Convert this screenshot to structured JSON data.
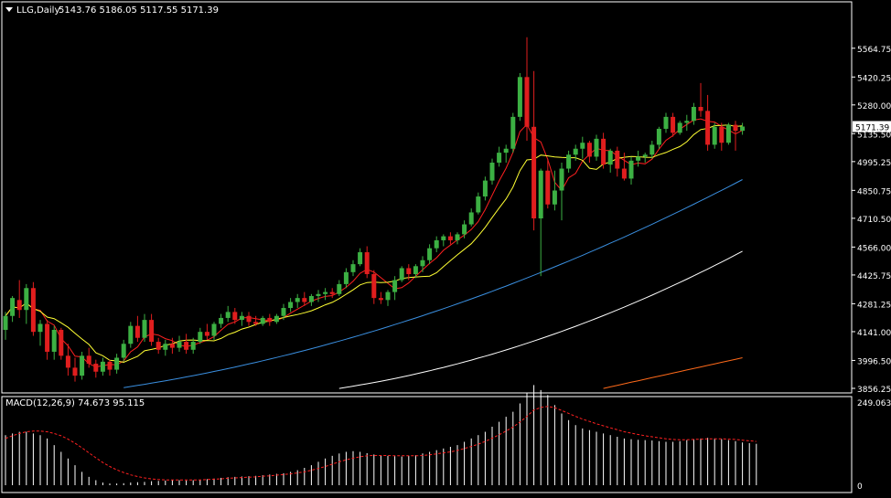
{
  "header": {
    "symbol_label": "LLG,Daily",
    "ohlc_text": "5143.76 5186.05 5117.55 5171.39"
  },
  "colors": {
    "background": "#000000",
    "bull": "#3cb043",
    "bear": "#e01e1e",
    "ma_fast": "#ff2020",
    "ma_mid": "#ffff33",
    "ma_50": "#3a8fe0",
    "ma_100": "#ffffff",
    "ma_200": "#ff6a1a",
    "grid": "#ffffff",
    "macd_hist": "#ffffff",
    "macd_signal": "#ff2020"
  },
  "chart_data": [
    {
      "type": "candlestick",
      "title": "LLG,Daily",
      "ylim": [
        3856.25,
        5664.75
      ],
      "yticks": [
        "5564.75",
        "5420.25",
        "5280.00",
        "5135.50",
        "4995.25",
        "4850.75",
        "4710.50",
        "4566.00",
        "4425.75",
        "4281.25",
        "4141.00",
        "3996.50",
        "3856.25"
      ],
      "last_price_label": "5171.39",
      "last_price": 5171.39,
      "candles": [
        [
          4150,
          4240,
          4100,
          4220
        ],
        [
          4220,
          4320,
          4190,
          4310
        ],
        [
          4300,
          4400,
          4210,
          4250
        ],
        [
          4250,
          4380,
          4180,
          4360
        ],
        [
          4360,
          4390,
          4120,
          4140
        ],
        [
          4140,
          4200,
          4070,
          4180
        ],
        [
          4180,
          4200,
          4000,
          4040
        ],
        [
          4040,
          4170,
          4000,
          4150
        ],
        [
          4150,
          4160,
          4000,
          4020
        ],
        [
          4020,
          4080,
          3920,
          3960
        ],
        [
          3960,
          4010,
          3890,
          3920
        ],
        [
          3920,
          4040,
          3900,
          4020
        ],
        [
          4020,
          4060,
          3960,
          3980
        ],
        [
          3980,
          4000,
          3910,
          3940
        ],
        [
          3940,
          4010,
          3920,
          3990
        ],
        [
          3990,
          4000,
          3920,
          3950
        ],
        [
          3950,
          4030,
          3930,
          4010
        ],
        [
          4010,
          4100,
          3990,
          4080
        ],
        [
          4080,
          4190,
          4060,
          4170
        ],
        [
          4170,
          4220,
          4090,
          4110
        ],
        [
          4110,
          4230,
          4090,
          4200
        ],
        [
          4200,
          4230,
          4070,
          4090
        ],
        [
          4090,
          4110,
          4030,
          4050
        ],
        [
          4050,
          4100,
          4020,
          4080
        ],
        [
          4080,
          4110,
          4030,
          4060
        ],
        [
          4060,
          4120,
          4040,
          4090
        ],
        [
          4090,
          4130,
          4030,
          4050
        ],
        [
          4050,
          4110,
          4030,
          4090
        ],
        [
          4090,
          4160,
          4080,
          4140
        ],
        [
          4140,
          4180,
          4100,
          4120
        ],
        [
          4120,
          4190,
          4100,
          4180
        ],
        [
          4180,
          4230,
          4160,
          4210
        ],
        [
          4210,
          4270,
          4190,
          4240
        ],
        [
          4240,
          4260,
          4180,
          4200
        ],
        [
          4200,
          4240,
          4170,
          4220
        ],
        [
          4220,
          4240,
          4170,
          4190
        ],
        [
          4190,
          4220,
          4170,
          4180
        ],
        [
          4180,
          4220,
          4170,
          4210
        ],
        [
          4210,
          4230,
          4170,
          4190
        ],
        [
          4190,
          4230,
          4180,
          4220
        ],
        [
          4220,
          4280,
          4200,
          4260
        ],
        [
          4260,
          4310,
          4240,
          4290
        ],
        [
          4290,
          4330,
          4260,
          4310
        ],
        [
          4310,
          4340,
          4270,
          4290
        ],
        [
          4290,
          4330,
          4270,
          4320
        ],
        [
          4320,
          4350,
          4290,
          4330
        ],
        [
          4330,
          4360,
          4300,
          4340
        ],
        [
          4340,
          4360,
          4310,
          4330
        ],
        [
          4330,
          4400,
          4320,
          4380
        ],
        [
          4380,
          4460,
          4360,
          4440
        ],
        [
          4440,
          4500,
          4420,
          4480
        ],
        [
          4480,
          4560,
          4470,
          4540
        ],
        [
          4540,
          4570,
          4410,
          4430
        ],
        [
          4430,
          4450,
          4280,
          4310
        ],
        [
          4310,
          4340,
          4280,
          4300
        ],
        [
          4300,
          4350,
          4270,
          4340
        ],
        [
          4340,
          4420,
          4300,
          4400
        ],
        [
          4400,
          4470,
          4390,
          4460
        ],
        [
          4460,
          4480,
          4400,
          4430
        ],
        [
          4430,
          4480,
          4410,
          4470
        ],
        [
          4470,
          4520,
          4440,
          4500
        ],
        [
          4500,
          4580,
          4480,
          4560
        ],
        [
          4560,
          4620,
          4540,
          4600
        ],
        [
          4600,
          4630,
          4570,
          4620
        ],
        [
          4620,
          4640,
          4580,
          4600
        ],
        [
          4600,
          4640,
          4580,
          4630
        ],
        [
          4630,
          4700,
          4610,
          4680
        ],
        [
          4680,
          4760,
          4670,
          4740
        ],
        [
          4740,
          4840,
          4730,
          4820
        ],
        [
          4820,
          4920,
          4800,
          4900
        ],
        [
          4900,
          5010,
          4880,
          4990
        ],
        [
          4990,
          5070,
          4970,
          5040
        ],
        [
          5040,
          5080,
          4990,
          5060
        ],
        [
          5060,
          5240,
          5040,
          5220
        ],
        [
          5220,
          5440,
          5200,
          5420
        ],
        [
          5420,
          5620,
          5100,
          5170
        ],
        [
          5170,
          5450,
          4650,
          4710
        ],
        [
          4710,
          4960,
          4420,
          4950
        ],
        [
          4950,
          5010,
          4760,
          4780
        ],
        [
          4780,
          4950,
          4750,
          4850
        ],
        [
          4850,
          4990,
          4700,
          4960
        ],
        [
          4960,
          5050,
          4940,
          5030
        ],
        [
          5030,
          5080,
          5000,
          5060
        ],
        [
          5060,
          5120,
          5010,
          5090
        ],
        [
          5090,
          5100,
          4990,
          5020
        ],
        [
          5020,
          5130,
          5000,
          5110
        ],
        [
          5110,
          5140,
          4960,
          4980
        ],
        [
          4980,
          5060,
          4940,
          5050
        ],
        [
          5050,
          5070,
          4920,
          4960
        ],
        [
          4960,
          5040,
          4900,
          4910
        ],
        [
          4910,
          5020,
          4880,
          5000
        ],
        [
          5000,
          5050,
          4970,
          5020
        ],
        [
          5020,
          5040,
          4990,
          5030
        ],
        [
          5030,
          5100,
          5010,
          5080
        ],
        [
          5080,
          5170,
          5060,
          5160
        ],
        [
          5160,
          5240,
          5140,
          5220
        ],
        [
          5220,
          5240,
          5120,
          5140
        ],
        [
          5140,
          5200,
          5130,
          5190
        ],
        [
          5190,
          5230,
          5150,
          5200
        ],
        [
          5200,
          5290,
          5180,
          5270
        ],
        [
          5270,
          5390,
          5220,
          5250
        ],
        [
          5250,
          5330,
          5050,
          5080
        ],
        [
          5080,
          5190,
          5060,
          5170
        ],
        [
          5170,
          5190,
          5050,
          5090
        ],
        [
          5090,
          5190,
          5080,
          5180
        ],
        [
          5180,
          5200,
          5050,
          5150
        ],
        [
          5150,
          5190,
          5130,
          5171.39
        ]
      ]
    },
    {
      "type": "bar",
      "title": "MACD(12,26,9) 74.673 95.115",
      "yticks": [
        "249.063",
        "0"
      ],
      "ylim": [
        0,
        249.063
      ],
      "series": [
        {
          "name": "MACD",
          "values": [
            150,
            155,
            160,
            160,
            155,
            150,
            140,
            120,
            100,
            80,
            60,
            40,
            25,
            15,
            8,
            5,
            5,
            6,
            8,
            9,
            10,
            12,
            13,
            14,
            15,
            15,
            14,
            15,
            16,
            18,
            20,
            22,
            24,
            25,
            26,
            27,
            28,
            30,
            32,
            34,
            36,
            40,
            45,
            52,
            60,
            70,
            80,
            88,
            95,
            100,
            102,
            100,
            96,
            92,
            90,
            88,
            87,
            86,
            88,
            90,
            95,
            100,
            105,
            110,
            115,
            120,
            130,
            140,
            150,
            160,
            175,
            190,
            205,
            220,
            245,
            275,
            300,
            285,
            270,
            240,
            215,
            195,
            180,
            170,
            165,
            160,
            155,
            150,
            145,
            140,
            138,
            136,
            135,
            134,
            132,
            130,
            130,
            132,
            135,
            138,
            140,
            142,
            140,
            138,
            135,
            132,
            128,
            126,
            124
          ]
        },
        {
          "name": "Signal",
          "values": [
            140,
            148,
            155,
            160,
            162,
            162,
            160,
            155,
            148,
            138,
            126,
            112,
            97,
            82,
            68,
            56,
            46,
            38,
            31,
            26,
            22,
            19,
            17,
            16,
            16,
            16,
            16,
            16,
            16,
            17,
            18,
            19,
            21,
            22,
            23,
            24,
            25,
            27,
            28,
            30,
            32,
            34,
            37,
            40,
            45,
            50,
            56,
            63,
            70,
            76,
            81,
            85,
            88,
            89,
            89,
            89,
            88,
            88,
            88,
            88,
            89,
            91,
            94,
            97,
            100,
            104,
            110,
            116,
            123,
            131,
            141,
            151,
            162,
            174,
            189,
            206,
            225,
            233,
            236,
            232,
            224,
            215,
            206,
            198,
            191,
            184,
            178,
            172,
            166,
            160,
            156,
            152,
            148,
            145,
            142,
            139,
            137,
            136,
            136,
            137,
            138,
            139,
            139,
            139,
            138,
            137,
            135,
            133,
            131
          ]
        }
      ]
    }
  ]
}
